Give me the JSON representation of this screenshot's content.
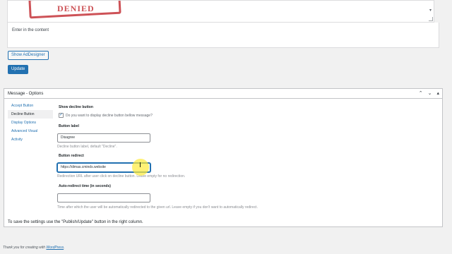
{
  "editor": {
    "placeholder_hint": "Enter in the content"
  },
  "buttons": {
    "show_addesigner": "Show AdDesigner",
    "update": "Update"
  },
  "metabox": {
    "title": "Message - Options",
    "icons": [
      "chevron-up-icon",
      "chevron-down-icon",
      "collapse-toggle-icon"
    ],
    "tabs": [
      {
        "label": "Accept Button",
        "active": false
      },
      {
        "label": "Decline Button",
        "active": true
      },
      {
        "label": "Display Options",
        "active": false
      },
      {
        "label": "Advanced Visual",
        "active": false
      },
      {
        "label": "Activity",
        "active": false
      }
    ],
    "show_decline": {
      "title": "Show decline button",
      "checkbox_label": "Do you want to display decline button bellow message?",
      "checked": true
    },
    "button_label": {
      "title": "Button label",
      "value": "Disagree",
      "hint": "Decline button label, default \"Decline\"."
    },
    "button_redirect": {
      "title": "Button redirect",
      "value": "https://dimas.cminds.website",
      "hint": "Redirection URL after user click on decline button. Leave empty for no redirection."
    },
    "auto_redirect": {
      "title": "Auto-redirect time (in seconds)",
      "value": "",
      "hint": "Time after which the user will be automatically redirected to the given url. Leave empty if you don't want to automatically redirect."
    },
    "save_note": "To save the settings use the \"Publish/Update\" button in the right column."
  },
  "footer": {
    "prefix": "Thank you for creating with ",
    "link": "WordPress",
    "suffix": "."
  },
  "colors": {
    "accent": "#2271b1",
    "stamp": "#c0272d",
    "cursor_highlight": "#ffeb3b"
  }
}
